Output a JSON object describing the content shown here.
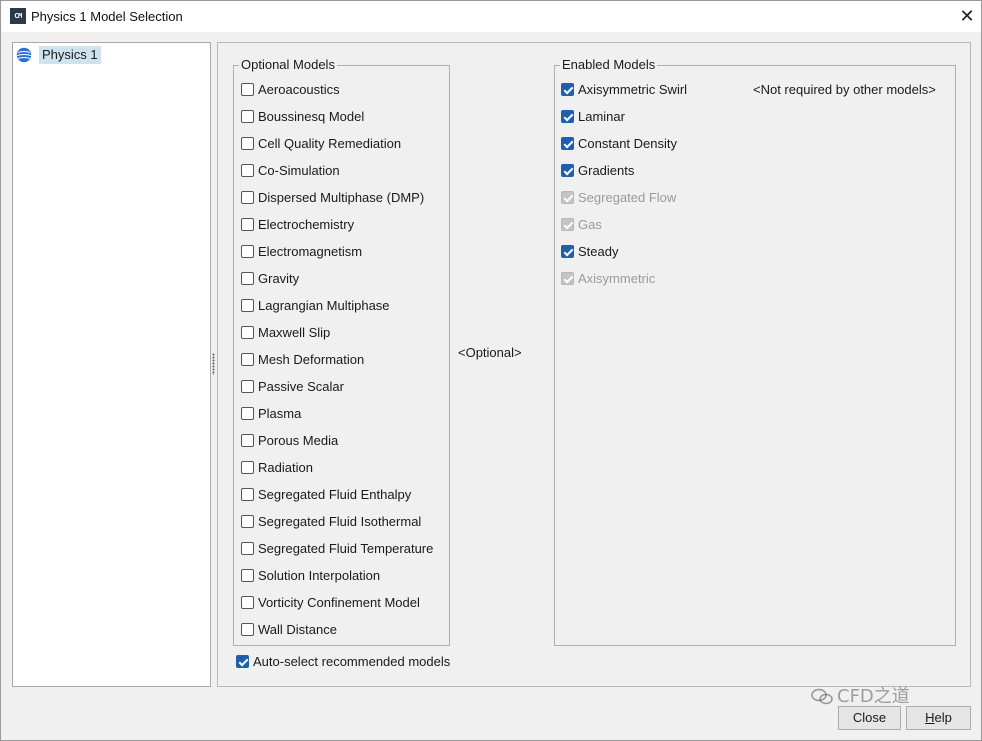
{
  "window": {
    "title": "Physics 1 Model Selection",
    "app_icon_text": "CM",
    "close_glyph": "✕"
  },
  "tree": {
    "items": [
      {
        "label": "Physics 1",
        "icon": "globe-icon",
        "selected": true
      }
    ]
  },
  "optional_models": {
    "title": "Optional Models",
    "items": [
      "Aeroacoustics",
      "Boussinesq Model",
      "Cell Quality Remediation",
      "Co-Simulation",
      "Dispersed Multiphase (DMP)",
      "Electrochemistry",
      "Electromagnetism",
      "Gravity",
      "Lagrangian Multiphase",
      "Maxwell Slip",
      "Mesh Deformation",
      "Passive Scalar",
      "Plasma",
      "Porous Media",
      "Radiation",
      "Segregated Fluid Enthalpy",
      "Segregated Fluid Isothermal",
      "Segregated Fluid Temperature",
      "Solution Interpolation",
      "Vorticity Confinement Model",
      "Wall Distance"
    ]
  },
  "center_label": "<Optional>",
  "enabled_models": {
    "title": "Enabled Models",
    "note": "<Not required by other models>",
    "items": [
      {
        "label": "Axisymmetric Swirl",
        "checked": true,
        "disabled": false
      },
      {
        "label": "Laminar",
        "checked": true,
        "disabled": false
      },
      {
        "label": "Constant Density",
        "checked": true,
        "disabled": false
      },
      {
        "label": "Gradients",
        "checked": true,
        "disabled": false
      },
      {
        "label": "Segregated Flow",
        "checked": true,
        "disabled": true
      },
      {
        "label": "Gas",
        "checked": true,
        "disabled": true
      },
      {
        "label": "Steady",
        "checked": true,
        "disabled": false
      },
      {
        "label": "Axisymmetric",
        "checked": true,
        "disabled": true
      }
    ]
  },
  "auto_select": {
    "label": "Auto-select recommended models",
    "checked": true
  },
  "buttons": {
    "close": "Close",
    "help_first": "H",
    "help_rest": "elp"
  },
  "watermark": {
    "text": "CFD之道"
  },
  "colors": {
    "accent": "#1f5fad",
    "selection": "#cfe3ef"
  }
}
